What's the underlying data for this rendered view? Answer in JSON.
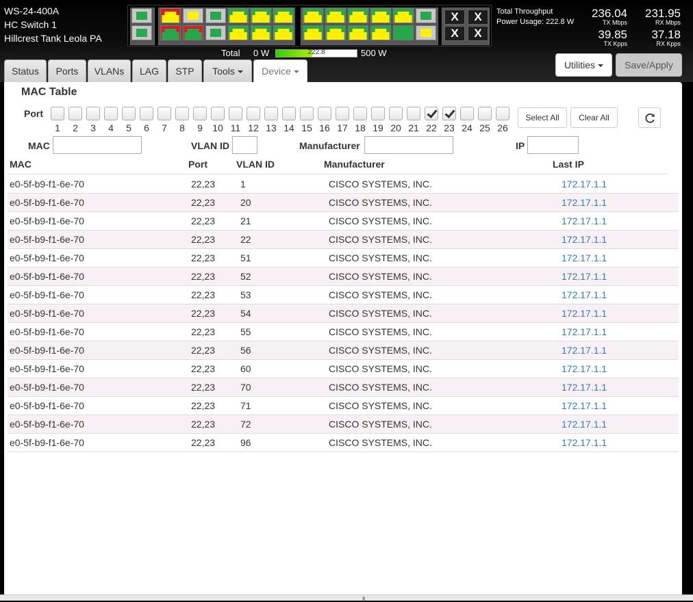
{
  "device": {
    "model": "WS-24-400A",
    "name": "HC Switch 1",
    "location": "Hillcrest Tank Leola PA"
  },
  "throughput": {
    "label": "Total Throughput",
    "power_usage": "Power Usage: 222.8 W",
    "tx_mbps": "236.04",
    "tx_mbps_unit": "TX Mbps",
    "rx_mbps": "231.95",
    "rx_mbps_unit": "RX Mbps",
    "tx_kpps": "39.85",
    "tx_kpps_unit": "TX Kpps",
    "rx_kpps": "37.18",
    "rx_kpps_unit": "RX Kpps"
  },
  "power": {
    "total_label": "Total",
    "min_label": "0 W",
    "value_label": "222.8",
    "max_label": "500 W",
    "fraction": 0.4456
  },
  "port_panel": {
    "x_label": "X"
  },
  "tabs": [
    {
      "label": "Status"
    },
    {
      "label": "Ports"
    },
    {
      "label": "VLANs"
    },
    {
      "label": "LAG"
    },
    {
      "label": "STP"
    },
    {
      "label": "Tools"
    },
    {
      "label": "Device"
    }
  ],
  "actions": {
    "utilities": "Utilities",
    "save_apply": "Save/Apply"
  },
  "mac_table": {
    "title": "MAC Table",
    "port_filter_label": "Port",
    "ports": [
      "1",
      "2",
      "3",
      "4",
      "5",
      "6",
      "7",
      "8",
      "9",
      "10",
      "11",
      "12",
      "13",
      "14",
      "15",
      "16",
      "17",
      "18",
      "19",
      "20",
      "21",
      "22",
      "23",
      "24",
      "25",
      "26"
    ],
    "checked_ports": [
      "22",
      "23"
    ],
    "select_all": "Select All",
    "clear_all": "Clear All",
    "filters": {
      "mac_label": "MAC",
      "mac_value": "",
      "vlan_label": "VLAN ID",
      "vlan_value": "",
      "manufacturer_label": "Manufacturer",
      "manufacturer_value": "",
      "ip_label": "IP",
      "ip_value": ""
    },
    "columns": {
      "mac": "MAC",
      "port": "Port",
      "vlan": "VLAN ID",
      "manufacturer": "Manufacturer",
      "last_ip": "Last IP"
    },
    "rows": [
      {
        "mac": "e0-5f-b9-f1-6e-70",
        "port": "22,23",
        "vlan": "1",
        "manufacturer": "CISCO SYSTEMS, INC.",
        "ip": "172.17.1.1"
      },
      {
        "mac": "e0-5f-b9-f1-6e-70",
        "port": "22,23",
        "vlan": "20",
        "manufacturer": "CISCO SYSTEMS, INC.",
        "ip": "172.17.1.1"
      },
      {
        "mac": "e0-5f-b9-f1-6e-70",
        "port": "22,23",
        "vlan": "21",
        "manufacturer": "CISCO SYSTEMS, INC.",
        "ip": "172.17.1.1"
      },
      {
        "mac": "e0-5f-b9-f1-6e-70",
        "port": "22,23",
        "vlan": "22",
        "manufacturer": "CISCO SYSTEMS, INC.",
        "ip": "172.17.1.1"
      },
      {
        "mac": "e0-5f-b9-f1-6e-70",
        "port": "22,23",
        "vlan": "51",
        "manufacturer": "CISCO SYSTEMS, INC.",
        "ip": "172.17.1.1"
      },
      {
        "mac": "e0-5f-b9-f1-6e-70",
        "port": "22,23",
        "vlan": "52",
        "manufacturer": "CISCO SYSTEMS, INC.",
        "ip": "172.17.1.1"
      },
      {
        "mac": "e0-5f-b9-f1-6e-70",
        "port": "22,23",
        "vlan": "53",
        "manufacturer": "CISCO SYSTEMS, INC.",
        "ip": "172.17.1.1"
      },
      {
        "mac": "e0-5f-b9-f1-6e-70",
        "port": "22,23",
        "vlan": "54",
        "manufacturer": "CISCO SYSTEMS, INC.",
        "ip": "172.17.1.1"
      },
      {
        "mac": "e0-5f-b9-f1-6e-70",
        "port": "22,23",
        "vlan": "55",
        "manufacturer": "CISCO SYSTEMS, INC.",
        "ip": "172.17.1.1"
      },
      {
        "mac": "e0-5f-b9-f1-6e-70",
        "port": "22,23",
        "vlan": "56",
        "manufacturer": "CISCO SYSTEMS, INC.",
        "ip": "172.17.1.1"
      },
      {
        "mac": "e0-5f-b9-f1-6e-70",
        "port": "22,23",
        "vlan": "60",
        "manufacturer": "CISCO SYSTEMS, INC.",
        "ip": "172.17.1.1"
      },
      {
        "mac": "e0-5f-b9-f1-6e-70",
        "port": "22,23",
        "vlan": "70",
        "manufacturer": "CISCO SYSTEMS, INC.",
        "ip": "172.17.1.1"
      },
      {
        "mac": "e0-5f-b9-f1-6e-70",
        "port": "22,23",
        "vlan": "71",
        "manufacturer": "CISCO SYSTEMS, INC.",
        "ip": "172.17.1.1"
      },
      {
        "mac": "e0-5f-b9-f1-6e-70",
        "port": "22,23",
        "vlan": "72",
        "manufacturer": "CISCO SYSTEMS, INC.",
        "ip": "172.17.1.1"
      },
      {
        "mac": "e0-5f-b9-f1-6e-70",
        "port": "22,23",
        "vlan": "96",
        "manufacturer": "CISCO SYSTEMS, INC.",
        "ip": "172.17.1.1"
      }
    ]
  }
}
